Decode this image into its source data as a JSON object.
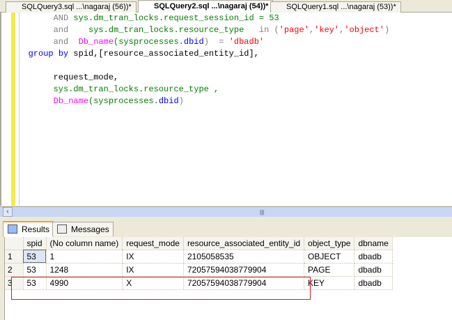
{
  "tabs": [
    {
      "label": "SQLQuery3.sql ...\\nagaraj (56))*"
    },
    {
      "label": "SQLQuery2.sql ...\\nagaraj (54))*",
      "active": true
    },
    {
      "label": "SQLQuery1.sql ...\\nagaraj (53))*"
    }
  ],
  "code": {
    "l1": [
      "        ",
      "AND",
      " ",
      "sys.dm_tran_locks.request_session_id = 53"
    ],
    "l2": [
      "        ",
      "and",
      "    ",
      "sys.dm_tran_locks.resource_type",
      "   in (",
      "'page'",
      ",",
      "'key'",
      ",",
      "'object'",
      ")"
    ],
    "l3": [
      "        ",
      "and",
      "  ",
      "Db_name",
      "(sysprocesses.",
      "dbid",
      ")  = ",
      "'dbadb'"
    ],
    "l4": [
      "   ",
      "group by",
      " spid,[resource_associated_entity_id],"
    ],
    "l6": [
      "        request_mode,"
    ],
    "l7": [
      "        ",
      "sys.dm_tran_locks.resource_type ,"
    ],
    "l8": [
      "        ",
      "Db_name",
      "(sysprocesses.",
      "dbid",
      ")"
    ]
  },
  "results": {
    "tabs": [
      "Results",
      "Messages"
    ],
    "columns": [
      "spid",
      "(No column name)",
      "request_mode",
      "resource_associated_entity_id",
      "object_type",
      "dbname"
    ],
    "rows": [
      [
        "1",
        "53",
        "1",
        "IX",
        "2105058535",
        "OBJECT",
        "dbadb"
      ],
      [
        "2",
        "53",
        "1248",
        "IX",
        "72057594038779904",
        "PAGE",
        "dbadb"
      ],
      [
        "3",
        "53",
        "4990",
        "X",
        "72057594038779904",
        "KEY",
        "dbadb"
      ]
    ]
  },
  "colors": {
    "highlight": "#e0141c",
    "keyword": "#0000ff",
    "function": "#ff00ff",
    "string": "#ff0000",
    "system": "#008000"
  }
}
